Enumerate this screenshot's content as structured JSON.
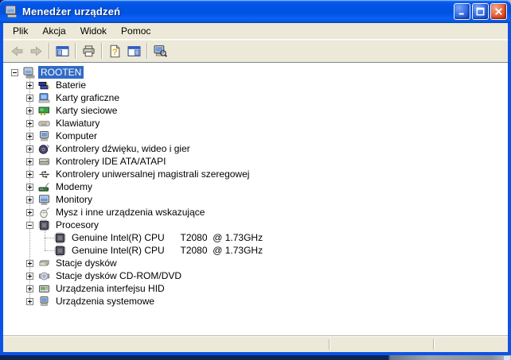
{
  "window": {
    "title": "Menedżer urządzeń",
    "title_icon": "device-manager-icon",
    "controls": [
      {
        "id": "minimize",
        "icon": "minimize-icon"
      },
      {
        "id": "maximize",
        "icon": "maximize-icon"
      },
      {
        "id": "close",
        "icon": "close-icon"
      }
    ]
  },
  "menu": {
    "items": [
      {
        "id": "plik",
        "label": "Plik"
      },
      {
        "id": "akcja",
        "label": "Akcja"
      },
      {
        "id": "widok",
        "label": "Widok"
      },
      {
        "id": "pomoc",
        "label": "Pomoc"
      }
    ]
  },
  "toolbar": {
    "items": [
      {
        "type": "button",
        "id": "back",
        "icon": "back-arrow-icon",
        "disabled": true
      },
      {
        "type": "button",
        "id": "forward",
        "icon": "forward-arrow-icon",
        "disabled": true
      },
      {
        "type": "separator"
      },
      {
        "type": "button",
        "id": "toggle-console-tree",
        "icon": "console-tree-icon"
      },
      {
        "type": "separator"
      },
      {
        "type": "button",
        "id": "print",
        "icon": "printer-icon"
      },
      {
        "type": "separator"
      },
      {
        "type": "button",
        "id": "help",
        "icon": "help-icon"
      },
      {
        "type": "button",
        "id": "show-action-pane",
        "icon": "action-pane-icon"
      },
      {
        "type": "separator"
      },
      {
        "type": "button",
        "id": "scan-hardware-changes",
        "icon": "scan-computer-icon"
      }
    ]
  },
  "tree": {
    "items": [
      {
        "id": "rooten",
        "level": 0,
        "expand": "minus",
        "icon": "computer-icon",
        "label": "ROOTEN",
        "selected": true
      },
      {
        "id": "baterie",
        "level": 1,
        "expand": "plus",
        "icon": "battery-icon",
        "label": "Baterie"
      },
      {
        "id": "karty-graficzne",
        "level": 1,
        "expand": "plus",
        "icon": "display-adapter-icon",
        "label": "Karty graficzne"
      },
      {
        "id": "karty-sieciowe",
        "level": 1,
        "expand": "plus",
        "icon": "network-adapter-icon",
        "label": "Karty sieciowe"
      },
      {
        "id": "klawiatury",
        "level": 1,
        "expand": "plus",
        "icon": "keyboard-icon",
        "label": "Klawiatury"
      },
      {
        "id": "komputer",
        "level": 1,
        "expand": "plus",
        "icon": "computer-device-icon",
        "label": "Komputer"
      },
      {
        "id": "kontrolery-dzwieku",
        "level": 1,
        "expand": "plus",
        "icon": "sound-controller-icon",
        "label": "Kontrolery dźwięku, wideo i gier"
      },
      {
        "id": "kontrolery-ide",
        "level": 1,
        "expand": "plus",
        "icon": "ide-controller-icon",
        "label": "Kontrolery IDE ATA/ATAPI"
      },
      {
        "id": "kontrolery-usb",
        "level": 1,
        "expand": "plus",
        "icon": "usb-controller-icon",
        "label": "Kontrolery uniwersalnej magistrali szeregowej"
      },
      {
        "id": "modemy",
        "level": 1,
        "expand": "plus",
        "icon": "modem-icon",
        "label": "Modemy"
      },
      {
        "id": "monitory",
        "level": 1,
        "expand": "plus",
        "icon": "monitor-icon",
        "label": "Monitory"
      },
      {
        "id": "mysz",
        "level": 1,
        "expand": "plus",
        "icon": "mouse-icon",
        "label": "Mysz i inne urządzenia wskazujące"
      },
      {
        "id": "procesory",
        "level": 1,
        "expand": "minus",
        "icon": "processor-icon",
        "label": "Procesory"
      },
      {
        "id": "cpu-1",
        "level": 2,
        "expand": "none",
        "icon": "processor-icon",
        "label": "Genuine Intel(R) CPU      T2080  @ 1.73GHz"
      },
      {
        "id": "cpu-2",
        "level": 2,
        "expand": "none",
        "icon": "processor-icon",
        "label": "Genuine Intel(R) CPU      T2080  @ 1.73GHz"
      },
      {
        "id": "stacje-dyskow",
        "level": 1,
        "expand": "plus",
        "icon": "disk-drive-icon",
        "label": "Stacje dysków"
      },
      {
        "id": "stacje-cdrom",
        "level": 1,
        "expand": "plus",
        "icon": "cdrom-drive-icon",
        "label": "Stacje dysków CD-ROM/DVD"
      },
      {
        "id": "urzadzenia-hid",
        "level": 1,
        "expand": "plus",
        "icon": "hid-device-icon",
        "label": "Urządzenia interfejsu HID"
      },
      {
        "id": "urzadzenia-systemowe",
        "level": 1,
        "expand": "plus",
        "icon": "system-device-icon",
        "label": "Urządzenia systemowe"
      }
    ]
  },
  "statusbar": {
    "sections": [
      "",
      "",
      ""
    ]
  },
  "colors": {
    "titlebar_blue": "#0153e2",
    "window_border": "#0b53e8",
    "chrome": "#ECE9D8",
    "selection": "#316AC5",
    "tree_background": "#ffffff",
    "desktop_navy": "#0d2455"
  }
}
